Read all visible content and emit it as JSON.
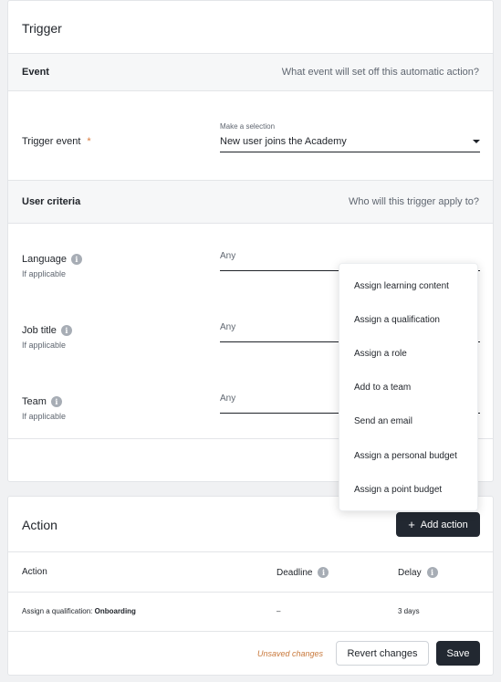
{
  "trigger": {
    "title": "Trigger",
    "event_section": {
      "label": "Event",
      "hint": "What event will set off this automatic action?"
    },
    "trigger_event": {
      "label": "Trigger event",
      "required": "*",
      "select_hint": "Make a selection",
      "value": "New user joins the Academy"
    },
    "criteria_section": {
      "label": "User criteria",
      "hint": "Who will this trigger apply to?"
    },
    "criteria": [
      {
        "label": "Language",
        "sub": "If applicable",
        "placeholder": "Any"
      },
      {
        "label": "Job title",
        "sub": "If applicable",
        "placeholder": "Any"
      },
      {
        "label": "Team",
        "sub": "If applicable",
        "placeholder": "Any"
      }
    ]
  },
  "dropdown": {
    "items": [
      "Assign learning content",
      "Assign a qualification",
      "Assign a role",
      "Add to a team",
      "Send an email",
      "Assign a personal budget",
      "Assign a point budget"
    ]
  },
  "action": {
    "title": "Action",
    "add_button": "Add action",
    "columns": {
      "action": "Action",
      "deadline": "Deadline",
      "delay": "Delay"
    },
    "rows": [
      {
        "action_prefix": "Assign a qualification: ",
        "action_name": "Onboarding",
        "deadline": "–",
        "delay": "3 days"
      }
    ],
    "unsaved": "Unsaved changes",
    "revert_button": "Revert changes",
    "save_button": "Save"
  },
  "icons": {
    "info": "info-icon",
    "caret": "caret-down-icon",
    "plus": "plus-icon"
  },
  "colors": {
    "primary_button": "#222831",
    "unsaved_text": "#c8783b",
    "required_mark": "#d97a3b"
  }
}
